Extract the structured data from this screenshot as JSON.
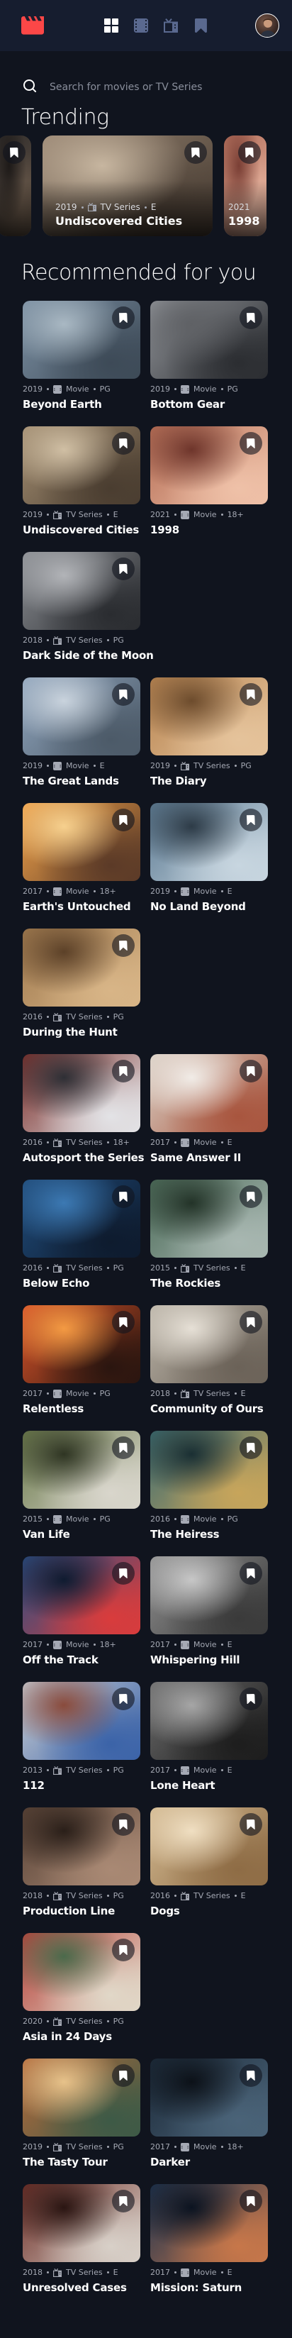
{
  "header": {
    "nav": [
      "home-icon",
      "movies-icon",
      "tv-series-icon",
      "bookmark-icon"
    ],
    "brand_color": "#fc4747",
    "active_nav": "home"
  },
  "search": {
    "placeholder": "Search for movies or TV Series"
  },
  "trending": {
    "title": "Trending",
    "items": [
      {
        "year": "",
        "category": "",
        "rating": "",
        "name": "",
        "colors": [
          "#2e2b2a",
          "#6b5a4b",
          "#1e1a18"
        ]
      },
      {
        "year": "2019",
        "category": "TV Series",
        "rating": "E",
        "name": "Undiscovered Cities",
        "colors": [
          "#9a8774",
          "#4b3f35",
          "#c7b6a0"
        ]
      },
      {
        "year": "2021",
        "category": "",
        "rating": "",
        "name": "1998",
        "colors": [
          "#b36f5c",
          "#e9b7a2",
          "#7a3f35"
        ]
      }
    ]
  },
  "recommended": {
    "title": "Recommended for you",
    "items": [
      {
        "year": "2019",
        "category": "Movie",
        "rating": "PG",
        "title": "Beyond Earth",
        "colors": [
          "#7b8fa2",
          "#3d4a57",
          "#a9b8c3"
        ]
      },
      {
        "year": "2019",
        "category": "Movie",
        "rating": "PG",
        "title": "Bottom Gear",
        "colors": [
          "#8f9297",
          "#2b2d31",
          "#5f6165"
        ]
      },
      {
        "year": "2019",
        "category": "TV Series",
        "rating": "E",
        "title": "Undiscovered Cities",
        "colors": [
          "#a28d71",
          "#4a3d30",
          "#d0bfa4"
        ]
      },
      {
        "year": "2021",
        "category": "Movie",
        "rating": "18+",
        "title": "1998",
        "colors": [
          "#b66f57",
          "#efc1a8",
          "#6e352b"
        ]
      },
      {
        "year": "2018",
        "category": "TV Series",
        "rating": "PG",
        "title": "Dark Side of the Moon",
        "colors": [
          "#8a8d92",
          "#2a2c30",
          "#b2b4b8"
        ]
      },
      {
        "year": "2019",
        "category": "Movie",
        "rating": "E",
        "title": "The Great Lands",
        "colors": [
          "#8fa4bc",
          "#4c5a68",
          "#c9d3dd"
        ]
      },
      {
        "year": "2019",
        "category": "TV Series",
        "rating": "PG",
        "title": "The Diary",
        "colors": [
          "#b88552",
          "#e5c39b",
          "#6d4c2d"
        ]
      },
      {
        "year": "2017",
        "category": "Movie",
        "rating": "18+",
        "title": "Earth's Untouched",
        "colors": [
          "#f0a24a",
          "#5b3a27",
          "#f6d08e"
        ]
      },
      {
        "year": "2019",
        "category": "Movie",
        "rating": "E",
        "title": "No Land Beyond",
        "colors": [
          "#5d7b93",
          "#c8d6e0",
          "#2d3b47"
        ]
      },
      {
        "year": "2016",
        "category": "TV Series",
        "rating": "PG",
        "title": "During the Hunt",
        "colors": [
          "#a07a4f",
          "#d8b587",
          "#5c4128"
        ]
      },
      {
        "year": "2016",
        "category": "TV Series",
        "rating": "18+",
        "title": "Autosport the Series",
        "colors": [
          "#7a2e2a",
          "#e3e3e6",
          "#2e2f35"
        ]
      },
      {
        "year": "2017",
        "category": "Movie",
        "rating": "E",
        "title": "Same Answer II",
        "colors": [
          "#d9cfc4",
          "#a8553e",
          "#f1ece7"
        ]
      },
      {
        "year": "2016",
        "category": "TV Series",
        "rating": "PG",
        "title": "Below Echo",
        "colors": [
          "#1f4a78",
          "#0e1b2e",
          "#3c79b3"
        ]
      },
      {
        "year": "2015",
        "category": "TV Series",
        "rating": "E",
        "title": "The Rockies",
        "colors": [
          "#4d6c5a",
          "#a8b7b1",
          "#233328"
        ]
      },
      {
        "year": "2017",
        "category": "Movie",
        "rating": "PG",
        "title": "Relentless",
        "colors": [
          "#d8542a",
          "#2a150f",
          "#f39a43"
        ]
      },
      {
        "year": "2018",
        "category": "TV Series",
        "rating": "E",
        "title": "Community of Ours",
        "colors": [
          "#b9b2a6",
          "#6b6258",
          "#e6e0d6"
        ]
      },
      {
        "year": "2015",
        "category": "Movie",
        "rating": "PG",
        "title": "Van Life",
        "colors": [
          "#6b7a4c",
          "#d9d6cc",
          "#2f3523"
        ]
      },
      {
        "year": "2016",
        "category": "Movie",
        "rating": "PG",
        "title": "The Heiress",
        "colors": [
          "#3e6b70",
          "#c7a55b",
          "#1a2f33"
        ]
      },
      {
        "year": "2017",
        "category": "Movie",
        "rating": "18+",
        "title": "Off the Track",
        "colors": [
          "#2c4e82",
          "#d93c3c",
          "#0f1b30"
        ]
      },
      {
        "year": "2017",
        "category": "Movie",
        "rating": "E",
        "title": "Whispering Hill",
        "colors": [
          "#8f8f8f",
          "#3a3a3a",
          "#c7c7c7"
        ]
      },
      {
        "year": "2013",
        "category": "TV Series",
        "rating": "PG",
        "title": "112",
        "colors": [
          "#c9cdd2",
          "#3b63a8",
          "#8a4b3c"
        ]
      },
      {
        "year": "2017",
        "category": "Movie",
        "rating": "E",
        "title": "Lone Heart",
        "colors": [
          "#6a6a6a",
          "#1d1d1d",
          "#a6a6a6"
        ]
      },
      {
        "year": "2018",
        "category": "TV Series",
        "rating": "PG",
        "title": "Production Line",
        "colors": [
          "#5a4438",
          "#a98974",
          "#2a1f19"
        ]
      },
      {
        "year": "2016",
        "category": "TV Series",
        "rating": "E",
        "title": "Dogs",
        "colors": [
          "#d2b890",
          "#8e6c45",
          "#f0dfc2"
        ]
      },
      {
        "year": "2020",
        "category": "TV Series",
        "rating": "PG",
        "title": "Asia in 24 Days",
        "colors": [
          "#b6413a",
          "#e1d8c8",
          "#4b6a4b"
        ]
      },
      {
        "year": "2019",
        "category": "TV Series",
        "rating": "PG",
        "title": "The Tasty Tour",
        "colors": [
          "#b46a3b",
          "#3d5a46",
          "#e7c28a"
        ]
      },
      {
        "year": "2017",
        "category": "Movie",
        "rating": "18+",
        "title": "Darker",
        "colors": [
          "#1d2b3a",
          "#4a6378",
          "#0c1118"
        ]
      },
      {
        "year": "2018",
        "category": "TV Series",
        "rating": "E",
        "title": "Unresolved Cases",
        "colors": [
          "#6e2f28",
          "#d8d0c8",
          "#2a1512"
        ]
      },
      {
        "year": "2017",
        "category": "Movie",
        "rating": "E",
        "title": "Mission: Saturn",
        "colors": [
          "#20344f",
          "#c7774a",
          "#0b1320"
        ]
      }
    ]
  }
}
